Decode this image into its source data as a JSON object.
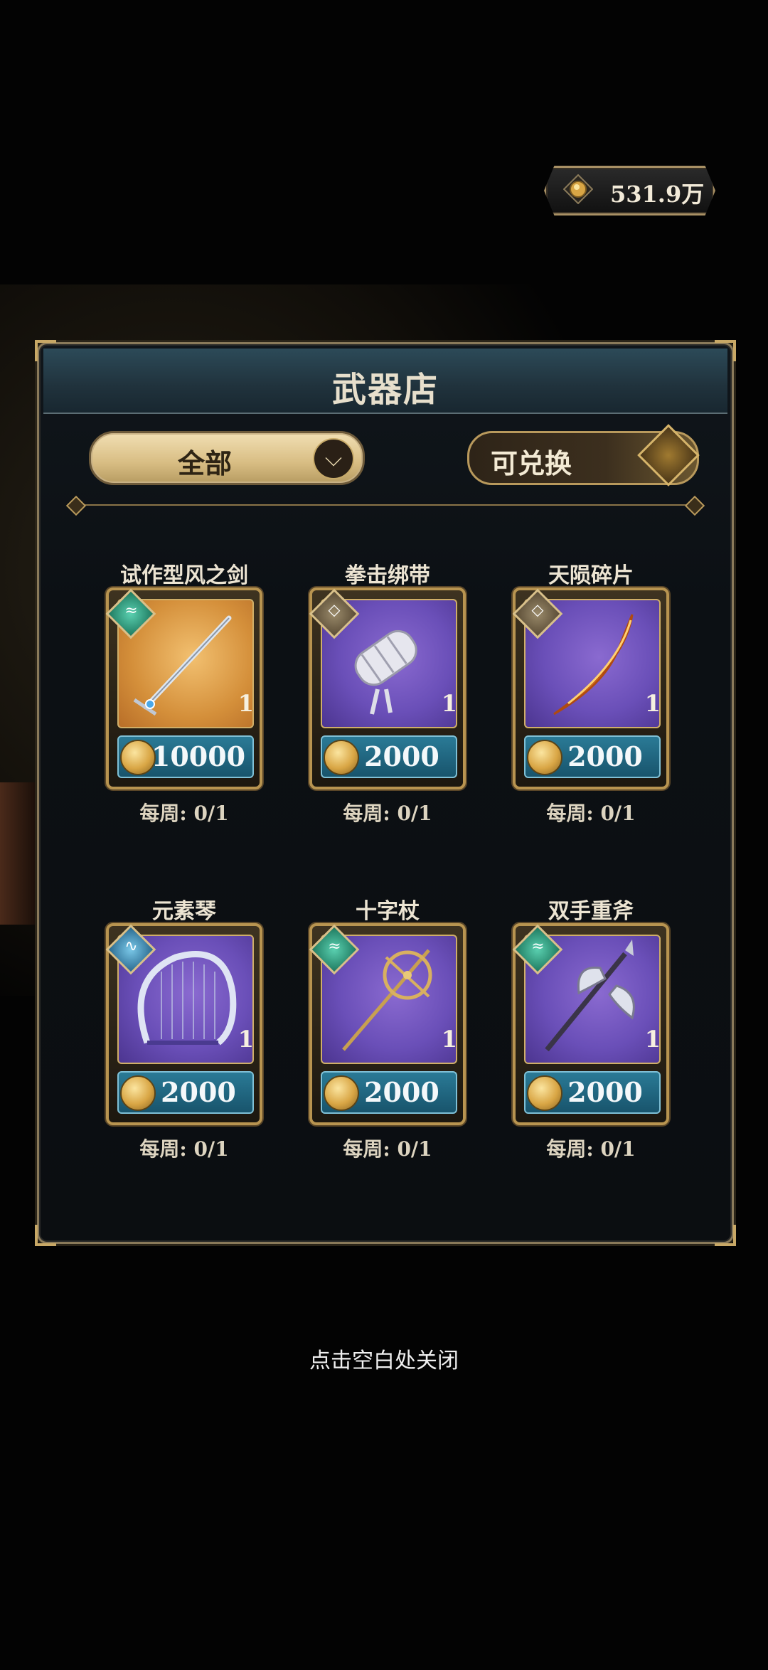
{
  "currency": {
    "value": "531.9万",
    "icon": "gold-coin-icon"
  },
  "shop": {
    "title": "武器店"
  },
  "filter": {
    "selected": "全部",
    "exchangeable_label": "可兑换"
  },
  "items": [
    {
      "name": "试作型风之剑",
      "qty": "1",
      "price": "10000",
      "limit": "每周: 0/1",
      "element": "wind",
      "rarity": "gold"
    },
    {
      "name": "拳击绑带",
      "qty": "1",
      "price": "2000",
      "limit": "每周: 0/1",
      "element": "earth",
      "rarity": "purple"
    },
    {
      "name": "天陨碎片",
      "qty": "1",
      "price": "2000",
      "limit": "每周: 0/1",
      "element": "earth",
      "rarity": "purple"
    },
    {
      "name": "元素琴",
      "qty": "1",
      "price": "2000",
      "limit": "每周: 0/1",
      "element": "water",
      "rarity": "purple"
    },
    {
      "name": "十字杖",
      "qty": "1",
      "price": "2000",
      "limit": "每周: 0/1",
      "element": "wind",
      "rarity": "purple"
    },
    {
      "name": "双手重斧",
      "qty": "1",
      "price": "2000",
      "limit": "每周: 0/1",
      "element": "wind",
      "rarity": "purple"
    }
  ],
  "hint": "点击空白处关闭"
}
